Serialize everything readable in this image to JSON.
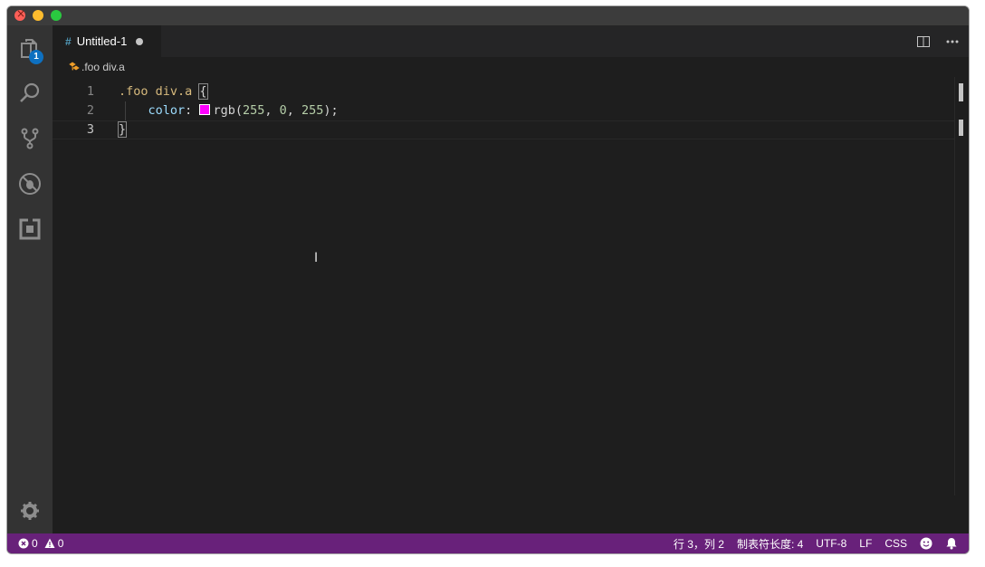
{
  "tab": {
    "icon_glyph": "#",
    "title": "Untitled-1",
    "dirty": true
  },
  "breadcrumb": {
    "text": ".foo div.a"
  },
  "activity_bar": {
    "explorer_badge": "1"
  },
  "editor": {
    "lines": [
      {
        "number": "1",
        "selector": ".foo div.a",
        "brace": "{"
      },
      {
        "number": "2",
        "property": "color",
        "colon": ":",
        "func": "rgb(",
        "n1": "255",
        "sep1": ", ",
        "n2": "0",
        "sep2": ", ",
        "n3": "255",
        "end": ");",
        "swatch_color": "#ff00ff"
      },
      {
        "number": "3",
        "brace": "}"
      }
    ]
  },
  "status_bar": {
    "errors": "0",
    "warnings": "0",
    "position": "行 3，列 2",
    "tab_size": "制表符长度: 4",
    "encoding": "UTF-8",
    "eol": "LF",
    "language": "CSS",
    "color": "#68217a"
  }
}
